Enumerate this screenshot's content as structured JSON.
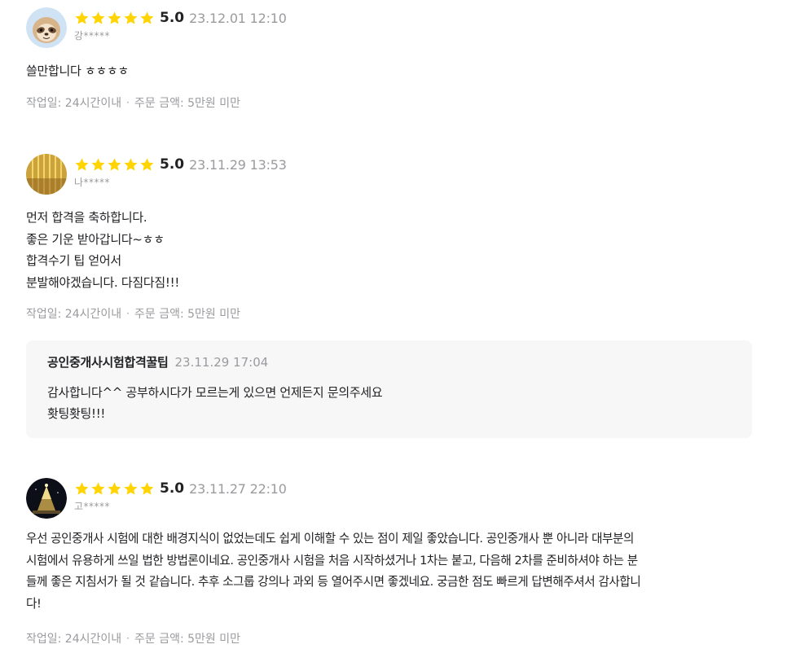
{
  "colors": {
    "star": "#FFD400",
    "text": "#212224",
    "muted": "#9A9B9E",
    "reply_bg": "#F7F7F8"
  },
  "reviews": [
    {
      "avatar_icon": "sloth-avatar",
      "stars": 5,
      "score": "5.0",
      "date": "23.12.01 12:10",
      "user": "강*****",
      "lines": [
        "쓸만합니다 ㅎㅎㅎㅎ"
      ],
      "work_time": "작업일: 24시간이내",
      "separator": "·",
      "order_amount": "주문 금액: 5만원 미만"
    },
    {
      "avatar_icon": "golden-pattern-avatar",
      "stars": 5,
      "score": "5.0",
      "date": "23.11.29 13:53",
      "user": "나*****",
      "lines": [
        "먼저 합격을 축하합니다.",
        "좋은 기운 받아갑니다~ㅎㅎ",
        "합격수기 팁 얻어서",
        "분발해야겠습니다. 다짐다짐!!!"
      ],
      "work_time": "작업일: 24시간이내",
      "separator": "·",
      "order_amount": "주문 금액: 5만원 미만",
      "reply": {
        "author": "공인중개사시험합격꿀팁",
        "date": "23.11.29 17:04",
        "lines": [
          "감사합니다^^ 공부하시다가 모르는게 있으면 언제든지 문의주세요",
          "홧팅홧팅!!!"
        ]
      }
    },
    {
      "avatar_icon": "night-tree-avatar",
      "stars": 5,
      "score": "5.0",
      "date": "23.11.27 22:10",
      "user": "고*****",
      "lines": [
        "우선 공인중개사 시험에 대한 배경지식이 없었는데도 쉽게 이해할 수 있는 점이 제일 좋았습니다. 공인중개사 뿐 아니라 대부분의",
        "시험에서 유용하게 쓰일 법한 방법론이네요. 공인중개사 시험을 처음 시작하셨거나 1차는 붙고, 다음해 2차를 준비하셔야 하는 분",
        "들께 좋은 지침서가 될 것 같습니다. 추후 소그룹 강의나 과외 등 열어주시면 좋겠네요. 궁금한 점도 빠르게 답변해주셔서 감사합니",
        "다!"
      ],
      "work_time": "작업일: 24시간이내",
      "separator": "·",
      "order_amount": "주문 금액: 5만원 미만"
    }
  ]
}
